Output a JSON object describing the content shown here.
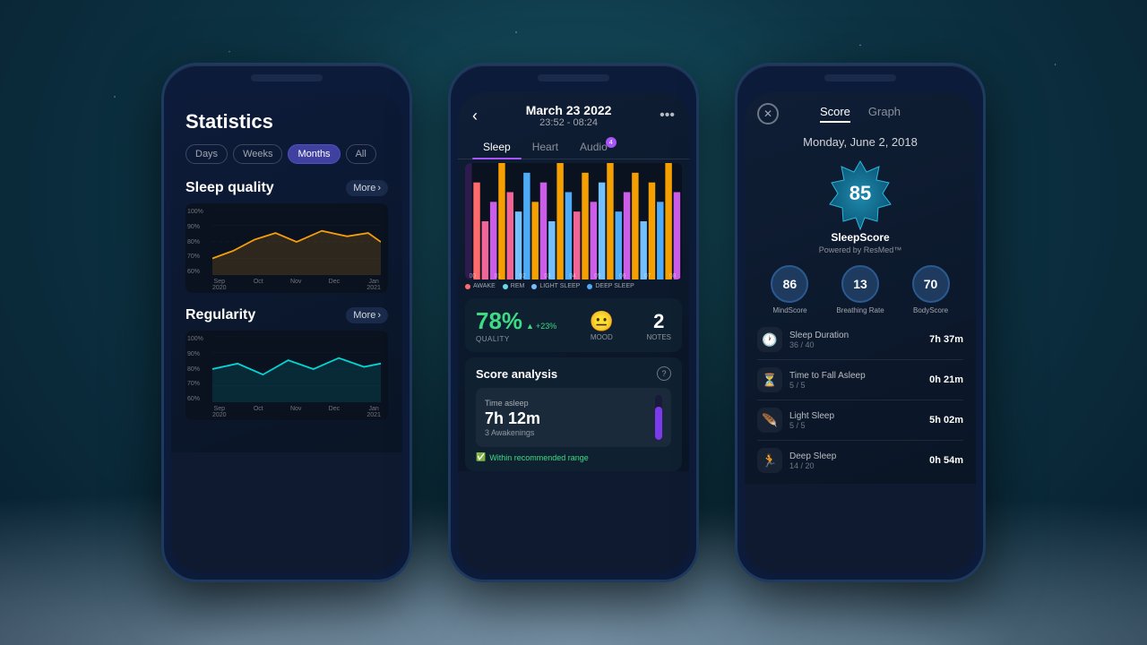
{
  "background": {
    "gradient": "radial-gradient(ellipse at 50% 30%, #1a5a6a 0%, #0d3545 40%, #071e2e 100%)"
  },
  "phone1": {
    "title": "Statistics",
    "tabs": [
      "Days",
      "Weeks",
      "Months",
      "All"
    ],
    "active_tab": "Months",
    "sections": [
      {
        "title": "Sleep quality",
        "more_label": "More",
        "y_labels": [
          "100%",
          "90%",
          "80%",
          "70%",
          "60%"
        ],
        "x_labels": [
          {
            "line1": "Sep",
            "line2": "2020"
          },
          {
            "line1": "Oct",
            "line2": ""
          },
          {
            "line1": "Nov",
            "line2": ""
          },
          {
            "line1": "Dec",
            "line2": ""
          },
          {
            "line1": "Jan",
            "line2": "2021"
          }
        ]
      },
      {
        "title": "Regularity",
        "more_label": "More",
        "y_labels": [
          "100%",
          "90%",
          "80%",
          "70%",
          "60%"
        ],
        "x_labels": [
          {
            "line1": "Sep",
            "line2": "2020"
          },
          {
            "line1": "Oct",
            "line2": ""
          },
          {
            "line1": "Nov",
            "line2": ""
          },
          {
            "line1": "Dec",
            "line2": ""
          },
          {
            "line1": "Jan",
            "line2": "2021"
          }
        ]
      }
    ]
  },
  "phone2": {
    "date": "March 23 2022",
    "time_range": "23:52 - 08:24",
    "tabs": [
      "Sleep",
      "Heart",
      "Audio"
    ],
    "audio_badge": "4",
    "quality_pct": "78%",
    "quality_label": "QUALITY",
    "quality_change": "+23%",
    "mood_emoji": "😐",
    "mood_label": "MOOD",
    "notes_num": "2",
    "notes_label": "NOTES",
    "score_analysis_title": "Score analysis",
    "time_asleep_label": "Time asleep",
    "time_asleep_value": "7h 12m",
    "awakenings": "3 Awakenings",
    "recommended_text": "Within recommended range",
    "legend": [
      {
        "color": "#ff6b6b",
        "label": "AWAKE"
      },
      {
        "color": "#66d9e8",
        "label": "REM"
      },
      {
        "color": "#74c0fc",
        "label": "LIGHT SLEEP"
      },
      {
        "color": "#4dabf7",
        "label": "DEEP SLEEP"
      }
    ]
  },
  "phone3": {
    "tabs": [
      "Score",
      "Graph"
    ],
    "active_tab": "Score",
    "date": "Monday, June 2, 2018",
    "sleep_score": "85",
    "sleep_score_name": "SleepScore",
    "powered_by": "Powered by ResMed™",
    "metrics": [
      {
        "value": "86",
        "label": "MindScore",
        "color": "#1e3a5f"
      },
      {
        "value": "13",
        "label": "Breathing Rate",
        "color": "#1e3a5f"
      },
      {
        "value": "70",
        "label": "BodyScore",
        "color": "#1e3a5f"
      }
    ],
    "stats": [
      {
        "icon": "🕐",
        "name": "Sleep Duration",
        "score": "36 / 40",
        "value": "7h 37m"
      },
      {
        "icon": "⏳",
        "name": "Time to Fall Asleep",
        "score": "5 / 5",
        "value": "0h 21m"
      },
      {
        "icon": "🪶",
        "name": "Light Sleep",
        "score": "5 / 5",
        "value": "5h 02m"
      },
      {
        "icon": "🏃",
        "name": "Deep Sleep",
        "score": "14 / 20",
        "value": "0h 54m"
      }
    ]
  }
}
